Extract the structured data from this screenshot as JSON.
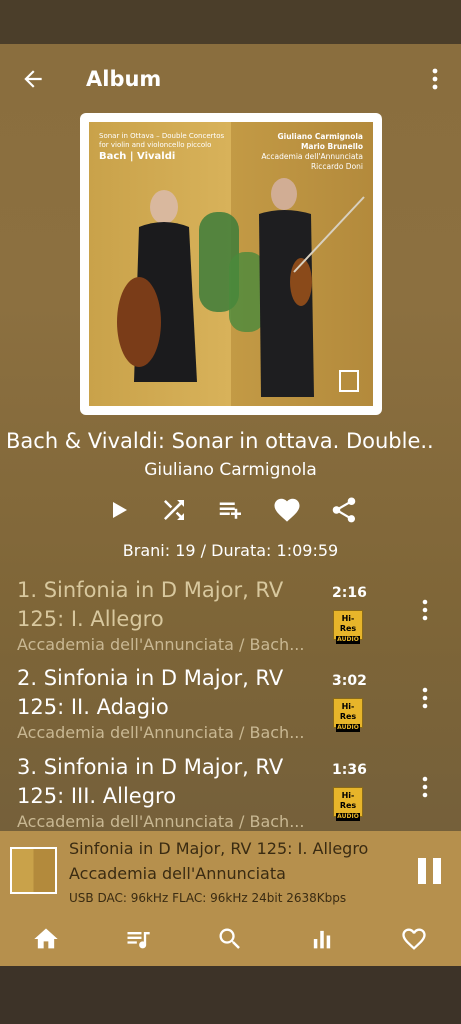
{
  "header": {
    "title": "Album"
  },
  "cover": {
    "left_line1": "Sonar in Ottava – Double Concertos",
    "left_line2": "for violin and violoncello piccolo",
    "left_bold": "Bach | Vivaldi",
    "right_bold1": "Giuliano Carmignola",
    "right_bold2": "Mario Brunello",
    "right_line3": "Accademia dell'Annunciata",
    "right_line4": "Riccardo Doni"
  },
  "album": {
    "name": "Bach & Vivaldi: Sonar in ottava. Double..",
    "artist": "Giuliano Carmignola",
    "stats": "Brani: 19 / Durata: 1:09:59"
  },
  "actions": [
    "play-icon",
    "shuffle-icon",
    "add-to-queue-icon",
    "heart-icon",
    "share-icon"
  ],
  "tracks": [
    {
      "title": "1. Sinfonia in D Major, RV 125: I. Allegro",
      "subtitle": "Accademia dell'Annunciata / Bach...",
      "time": "2:16",
      "badge_top": "Hi-Res",
      "badge_bottom": "AUDIO"
    },
    {
      "title": "2. Sinfonia in D Major, RV 125: II. Adagio",
      "subtitle": "Accademia dell'Annunciata / Bach...",
      "time": "3:02",
      "badge_top": "Hi-Res",
      "badge_bottom": "AUDIO"
    },
    {
      "title": "3. Sinfonia in D Major, RV 125: III. Allegro",
      "subtitle": "Accademia dell'Annunciata / Bach...",
      "time": "1:36",
      "badge_top": "Hi-Res",
      "badge_bottom": "AUDIO"
    }
  ],
  "player": {
    "track": "Sinfonia in D Major, RV 125: I. Allegro",
    "artist": "Accademia dell'Annunciata",
    "format": "USB DAC: 96kHz  FLAC: 96kHz  24bit   2638Kbps"
  },
  "nav": [
    "home-icon",
    "queue-icon",
    "search-icon",
    "equalizer-icon",
    "favorites-icon"
  ],
  "colors": {
    "accent": "#b6904d",
    "badge": "#e7b52a"
  }
}
